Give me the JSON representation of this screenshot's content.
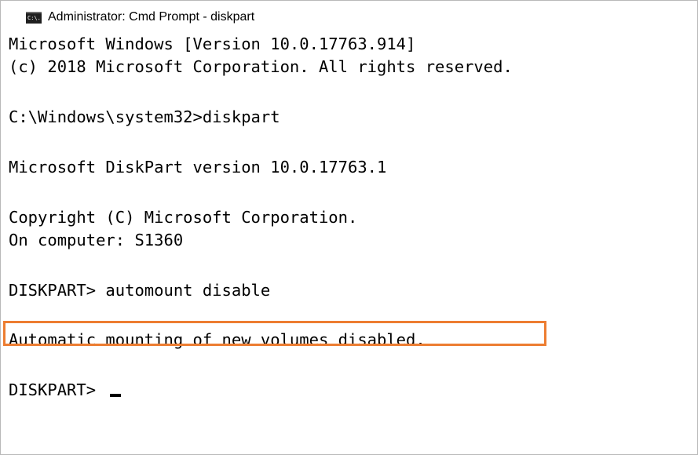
{
  "window": {
    "title": "Administrator: Cmd Prompt - diskpart",
    "icon": "cmd-prompt-icon",
    "icon_text": "C:\\."
  },
  "console": {
    "lines": [
      "Microsoft Windows [Version 10.0.17763.914]",
      "(c) 2018 Microsoft Corporation. All rights reserved.",
      "C:\\Windows\\system32>diskpart",
      "Microsoft DiskPart version 10.0.17763.1",
      "Copyright (C) Microsoft Corporation.",
      "On computer: S1360",
      "DISKPART> automount disable",
      "Automatic mounting of new volumes disabled.",
      "DISKPART> "
    ],
    "highlighted_line_index": 7,
    "highlight_color": "#ed7d31"
  }
}
